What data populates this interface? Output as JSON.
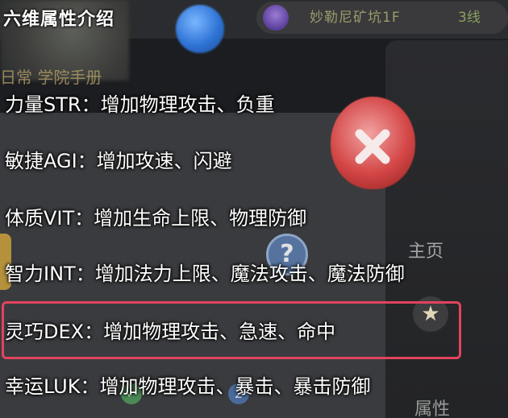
{
  "title": "六维属性介绍",
  "background": {
    "location": "妙勒尼矿坑1F",
    "line": "3线",
    "daily_tabs": "日常  学院手册",
    "main_label": "主页",
    "attr_label": "属性"
  },
  "attributes": [
    {
      "name": "力量STR",
      "sep": "：",
      "desc": "增加物理攻击、负重"
    },
    {
      "name": "敏捷AGI",
      "sep": "：",
      "desc": "增加攻速、闪避"
    },
    {
      "name": "体质VIT",
      "sep": "：",
      "desc": "增加生命上限、物理防御"
    },
    {
      "name": "智力INT",
      "sep": "：",
      "desc": "增加法力上限、魔法攻击、魔法防御"
    },
    {
      "name": "灵巧DEX",
      "sep": "：",
      "desc": "增加物理攻击、急速、命中"
    },
    {
      "name": "幸运LUK",
      "sep": "：",
      "desc": "增加物理攻击、暴击、暴击防御"
    }
  ],
  "highlight_color": "#e2435e"
}
